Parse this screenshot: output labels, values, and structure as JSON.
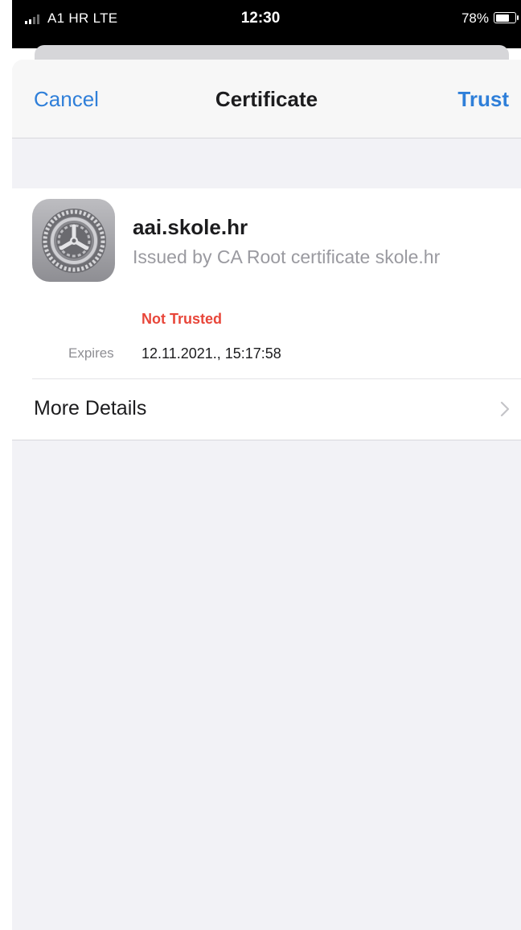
{
  "status_bar": {
    "carrier": "A1 HR  LTE",
    "time": "12:30",
    "battery_percent": "78%",
    "battery_level": 0.78,
    "signal_icon": "signal-bars-icon",
    "battery_icon": "battery-icon"
  },
  "nav": {
    "cancel_label": "Cancel",
    "title": "Certificate",
    "trust_label": "Trust"
  },
  "certificate": {
    "icon": "settings-gear-icon",
    "name": "aai.skole.hr",
    "issuer": "Issued by CA Root certificate skole.hr",
    "status": "Not Trusted",
    "expires_label": "Expires",
    "expires_value": "12.11.2021., 15:17:58"
  },
  "more_details": {
    "label": "More Details",
    "chevron_icon": "chevron-right-icon"
  },
  "colors": {
    "accent": "#2f7fd9",
    "warning": "#e8463a",
    "background": "#f2f2f6"
  }
}
